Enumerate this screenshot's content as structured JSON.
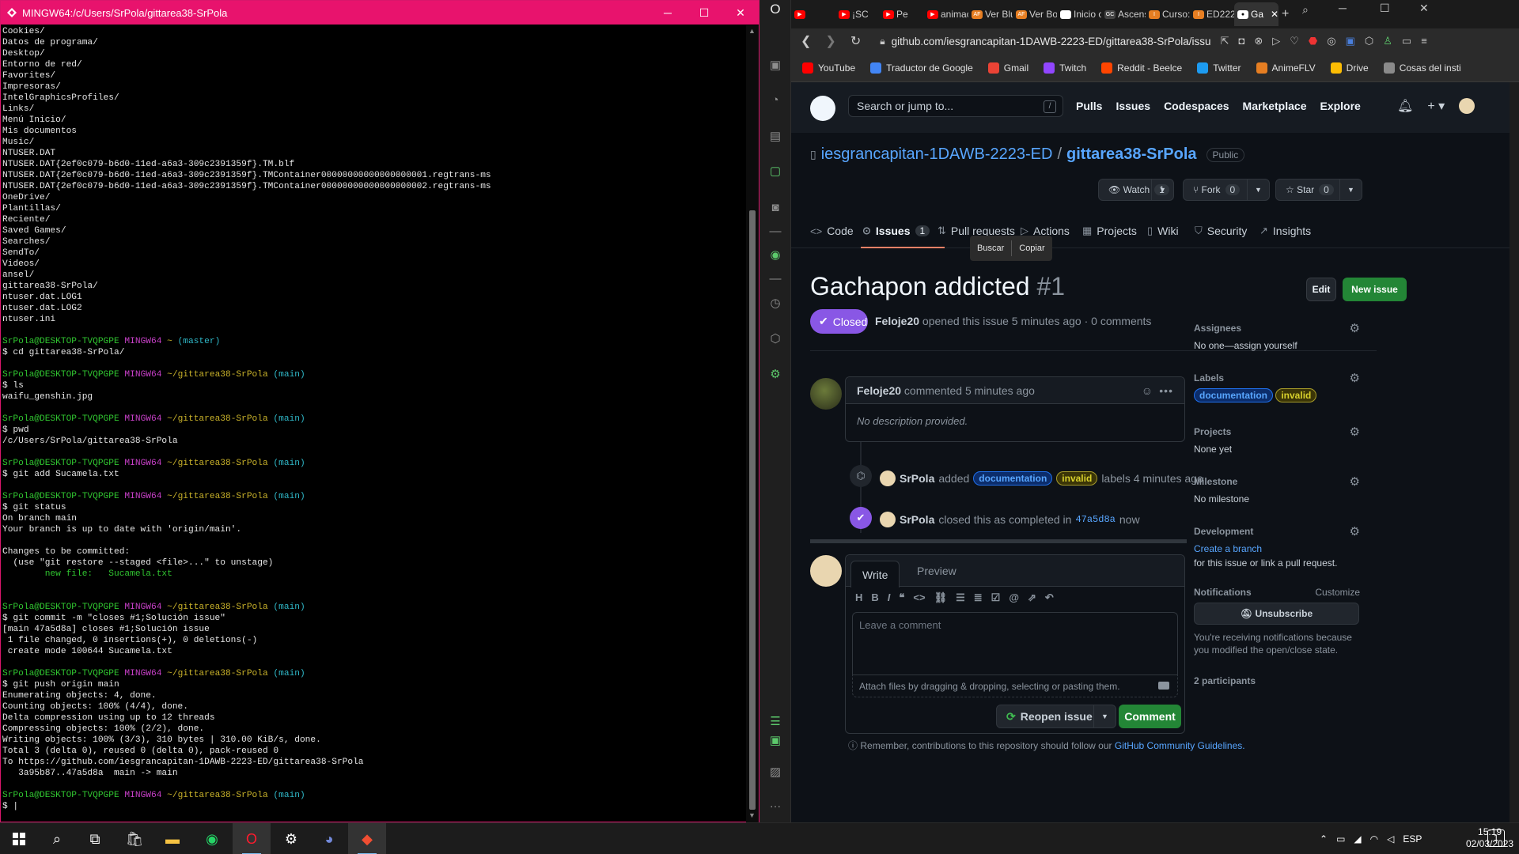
{
  "terminal": {
    "title": "MINGW64:/c/Users/SrPola/gittarea38-SrPola",
    "lines": [
      "Cookies/",
      "Datos de programa/",
      "Desktop/",
      "Entorno de red/",
      "Favorites/",
      "Impresoras/",
      "IntelGraphicsProfiles/",
      "Links/",
      "Menú Inicio/",
      "Mis documentos",
      "Music/",
      "NTUSER.DAT",
      "NTUSER.DAT{2ef0c079-b6d0-11ed-a6a3-309c2391359f}.TM.blf",
      "NTUSER.DAT{2ef0c079-b6d0-11ed-a6a3-309c2391359f}.TMContainer00000000000000000001.regtrans-ms",
      "NTUSER.DAT{2ef0c079-b6d0-11ed-a6a3-309c2391359f}.TMContainer00000000000000000002.regtrans-ms",
      "OneDrive/",
      "Plantillas/",
      "Reciente/",
      "Saved Games/",
      "Searches/",
      "SendTo/",
      "Videos/",
      "ansel/",
      "gittarea38-SrPola/",
      "ntuser.dat.LOG1",
      "ntuser.dat.LOG2",
      "ntuser.ini",
      "",
      {
        "u": "SrPola@DESKTOP-TVQPGPE",
        "s": "MINGW64",
        "p": "~",
        "b": "(master)"
      },
      "$ cd gittarea38-SrPola/",
      "",
      {
        "u": "SrPola@DESKTOP-TVQPGPE",
        "s": "MINGW64",
        "p": "~/gittarea38-SrPola",
        "b": "(main)"
      },
      "$ ls",
      "waifu_genshin.jpg",
      "",
      {
        "u": "SrPola@DESKTOP-TVQPGPE",
        "s": "MINGW64",
        "p": "~/gittarea38-SrPola",
        "b": "(main)"
      },
      "$ pwd",
      "/c/Users/SrPola/gittarea38-SrPola",
      "",
      {
        "u": "SrPola@DESKTOP-TVQPGPE",
        "s": "MINGW64",
        "p": "~/gittarea38-SrPola",
        "b": "(main)"
      },
      "$ git add Sucamela.txt",
      "",
      {
        "u": "SrPola@DESKTOP-TVQPGPE",
        "s": "MINGW64",
        "p": "~/gittarea38-SrPola",
        "b": "(main)"
      },
      "$ git status",
      "On branch main",
      "Your branch is up to date with 'origin/main'.",
      "",
      "Changes to be committed:",
      "  (use \"git restore --staged <file>...\" to unstage)",
      {
        "green": "        new file:   Sucamela.txt"
      },
      "",
      "",
      {
        "u": "SrPola@DESKTOP-TVQPGPE",
        "s": "MINGW64",
        "p": "~/gittarea38-SrPola",
        "b": "(main)"
      },
      "$ git commit -m \"closes #1;Solución issue\"",
      "[main 47a5d8a] closes #1;Solución issue",
      " 1 file changed, 0 insertions(+), 0 deletions(-)",
      " create mode 100644 Sucamela.txt",
      "",
      {
        "u": "SrPola@DESKTOP-TVQPGPE",
        "s": "MINGW64",
        "p": "~/gittarea38-SrPola",
        "b": "(main)"
      },
      "$ git push origin main",
      "Enumerating objects: 4, done.",
      "Counting objects: 100% (4/4), done.",
      "Delta compression using up to 12 threads",
      "Compressing objects: 100% (2/2), done.",
      "Writing objects: 100% (3/3), 310 bytes | 310.00 KiB/s, done.",
      "Total 3 (delta 0), reused 0 (delta 0), pack-reused 0",
      "To https://github.com/iesgrancapitan-1DAWB-2223-ED/gittarea38-SrPola",
      "   3a95b87..47a5d8a  main -> main",
      "",
      {
        "u": "SrPola@DESKTOP-TVQPGPE",
        "s": "MINGW64",
        "p": "~/gittarea38-SrPola",
        "b": "(main)"
      },
      "$ |"
    ]
  },
  "browser": {
    "tabs": [
      "¡SC",
      "Pe",
      "animac",
      "Ver Blu",
      "Ver Bo",
      "Inicio c",
      "Ascens",
      "Curso:",
      "ED222",
      "Ga"
    ],
    "url": "github.com/iesgrancapitan-1DAWB-2223-ED/gittarea38-SrPola/issu",
    "bookmarks": [
      {
        "label": "YouTube",
        "color": "#ff0000"
      },
      {
        "label": "Traductor de Google",
        "color": "#4285f4"
      },
      {
        "label": "Gmail",
        "color": "#ea4335"
      },
      {
        "label": "Twitch",
        "color": "#9146ff"
      },
      {
        "label": "Reddit - Beelce",
        "color": "#ff4500"
      },
      {
        "label": "Twitter",
        "color": "#1d9bf0"
      },
      {
        "label": "AnimeFLV",
        "color": "#e67e22"
      },
      {
        "label": "Drive",
        "color": "#fbbc04"
      },
      {
        "label": "Cosas del insti",
        "color": "#8a8a8a"
      }
    ]
  },
  "github": {
    "search_placeholder": "Search or jump to...",
    "search_key": "/",
    "nav": [
      "Pulls",
      "Issues",
      "Codespaces",
      "Marketplace",
      "Explore"
    ],
    "repo_owner": "iesgrancapitan-1DAWB-2223-ED",
    "repo_sep": "/",
    "repo_name": "gittarea38-SrPola",
    "visibility": "Public",
    "watch": {
      "label": "Watch",
      "count": "1"
    },
    "fork": {
      "label": "Fork",
      "count": "0"
    },
    "star": {
      "label": "Star",
      "count": "0"
    },
    "tabs": [
      {
        "label": "Code",
        "icon": "<>"
      },
      {
        "label": "Issues",
        "icon": "⊙",
        "count": "1"
      },
      {
        "label": "Pull requests",
        "icon": "⇅"
      },
      {
        "label": "Actions",
        "icon": "▷"
      },
      {
        "label": "Projects",
        "icon": "▦"
      },
      {
        "label": "Wiki",
        "icon": "▯"
      },
      {
        "label": "Security",
        "icon": "⛉"
      },
      {
        "label": "Insights",
        "icon": "↗"
      }
    ],
    "context_menu": [
      "Buscar",
      "Copiar"
    ],
    "issue_title": "Gachapon addicted",
    "issue_number": "#1",
    "edit": "Edit",
    "new_issue": "New issue",
    "state": "Closed",
    "meta_user": "Feloje20",
    "meta_rest": "opened this issue 5 minutes ago · 0 comments",
    "comment_user": "Feloje20",
    "comment_time": "commented 5 minutes ago",
    "comment_body": "No description provided.",
    "event1_user": "SrPola",
    "event1_added": "added",
    "label_doc": "documentation",
    "label_inv": "invalid",
    "event1_after": "labels 4 minutes ago",
    "event2_user": "SrPola",
    "event2_text": "closed this as completed in",
    "event2_commit": "47a5d8a",
    "event2_time": "now",
    "write_tab": "Write",
    "preview_tab": "Preview",
    "textarea_placeholder": "Leave a comment",
    "attach_text": "Attach files by dragging & dropping, selecting or pasting them.",
    "reopen": "Reopen issue",
    "comment_button": "Comment",
    "remember_text": "Remember, contributions to this repository should follow our",
    "remember_link": "GitHub Community Guidelines.",
    "sidebar": {
      "assignees_h": "Assignees",
      "assignees_v": "No one—assign yourself",
      "labels_h": "Labels",
      "projects_h": "Projects",
      "projects_v": "None yet",
      "milestone_h": "Milestone",
      "milestone_v": "No milestone",
      "development_h": "Development",
      "development_link": "Create a branch",
      "development_v": "for this issue or link a pull request.",
      "notifications_h": "Notifications",
      "customize": "Customize",
      "unsubscribe": "Unsubscribe",
      "notif_v": "You're receiving notifications because you modified the open/close state.",
      "participants": "2 participants"
    }
  },
  "taskbar": {
    "time": "15:19",
    "date": "02/03/2023",
    "lang": "ESP",
    "notif_count": "1"
  }
}
